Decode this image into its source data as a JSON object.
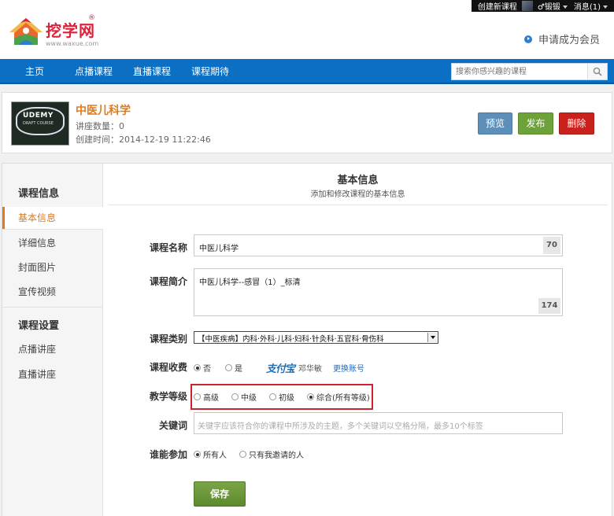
{
  "topbar": {
    "create_course": "创建新课程",
    "user": "锻锻",
    "messages": "消息(1)"
  },
  "header": {
    "logo_text": "挖学网",
    "logo_reg": "®",
    "logo_url": "www.waxue.com",
    "member_link": "申请成为会员"
  },
  "nav": {
    "items": [
      "主页",
      "点播课程",
      "直播课程",
      "课程期待"
    ],
    "search_placeholder": "搜索你感兴趣的课程"
  },
  "course": {
    "thumb_line1": "UDEMY",
    "thumb_line2": "DRAFT COURSE",
    "title": "中医儿科学",
    "lecture_count": "讲座数量：0",
    "created": "创建时间：2014-12-19 11:22:46",
    "preview_label": "预览",
    "publish_label": "发布",
    "delete_label": "删除"
  },
  "sidebar": {
    "group1": "课程信息",
    "group1_items": [
      "基本信息",
      "详细信息",
      "封面图片",
      "宣传视频"
    ],
    "group2": "课程设置",
    "group2_items": [
      "点播讲座",
      "直播讲座"
    ]
  },
  "form": {
    "title": "基本信息",
    "subtitle": "添加和修改课程的基本信息",
    "name_label": "课程名称",
    "name_value": "中医儿科学",
    "name_counter": "70",
    "intro_label": "课程简介",
    "intro_value": "中医儿科学--感冒（1）_标清",
    "intro_counter": "174",
    "category_label": "课程类别",
    "category_value": "【中医疾病】内科·外科·儿科·妇科·针灸科·五官科·骨伤科",
    "fee_label": "课程收费",
    "fee_no": "否",
    "fee_yes": "是",
    "alipay_logo": "支付宝",
    "alipay_name": "邓华敏",
    "change_account": "更换账号",
    "level_label": "教学等级",
    "level_options": [
      "高级",
      "中级",
      "初级",
      "综合(所有等级)"
    ],
    "keywords_label": "关键词",
    "keywords_placeholder": "关键字应该符合你的课程中所涉及的主题，多个关键词以空格分隔，最多10个标签",
    "audience_label": "谁能参加",
    "audience_options": [
      "所有人",
      "只有我邀请的人"
    ],
    "save_label": "保存"
  },
  "colors": {
    "nav_blue": "#0b6fc4",
    "accent_orange": "#e07a1a",
    "publish_green": "#6da23a",
    "delete_red": "#c9211c",
    "preview_blue": "#5e8fb8",
    "highlight_red": "#c9252b"
  }
}
